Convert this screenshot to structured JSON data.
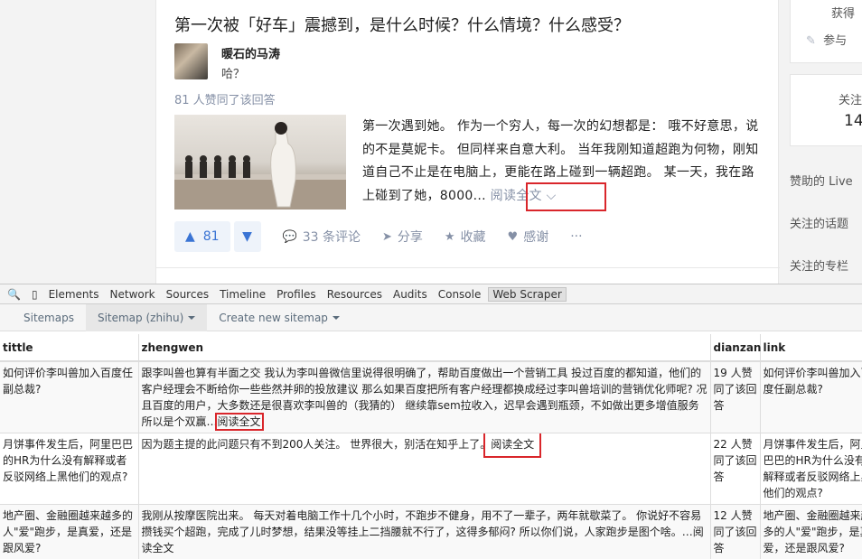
{
  "question": {
    "title": "第一次被「好车」震撼到，是什么时候？什么情境？什么感受？",
    "author": "暖石的马涛",
    "bio": "哈？",
    "likes": "81 人赞同了该回答",
    "answer_text": "第一次遇到她。 作为一个穷人，每一次的幻想都是： 哦不好意思，说的不是莫妮卡。 但同样来自意大利。 当年我刚知道超跑为何物，刚知道自己不止是在电脑上，更能在路上碰到一辆超跑。 某一天，我在路上碰到了她，8000...",
    "read_full": "阅读全文",
    "vote_count": "81",
    "actions": {
      "comments": "33 条评论",
      "share": "分享",
      "collect": "收藏",
      "thanks": "感谢",
      "more": "···"
    }
  },
  "right_sidebar": {
    "item1": "获得",
    "item2": "参与",
    "follow_label": "关注",
    "follow_count": "14",
    "live": "赞助的 Live",
    "topics": "关注的话题",
    "columns": "关注的专栏"
  },
  "devtools": {
    "tabs": [
      "Elements",
      "Network",
      "Sources",
      "Timeline",
      "Profiles",
      "Resources",
      "Audits",
      "Console",
      "Web Scraper"
    ],
    "active_tab": "Web Scraper"
  },
  "scraper": {
    "nav": [
      "Sitemaps",
      "Sitemap (zhihu)",
      "Create new sitemap"
    ],
    "columns": [
      "tittle",
      "zhengwen",
      "dianzan",
      "link"
    ],
    "rows": [
      {
        "tittle": "如何评价李叫兽加入百度任副总裁?",
        "zhengwen": "跟李叫兽也算有半面之交 我认为李叫兽微信里说得很明确了，帮助百度做出一个营销工具 投过百度的都知道，他们的客户经理会不断给你一些些然并卵的投放建议 那么如果百度把所有客户经理都换成经过李叫兽培训的营销优化师呢? 况且百度的用户，大多数还是很喜欢李叫兽的（我猜的） 继续靠sem拉收入，迟早会遇到瓶颈，不如做出更多增值服务 所以是个双赢…",
        "zhengwen_link": "阅读全文",
        "dianzan": "19 人赞同了该回答",
        "link": "如何评价李叫兽加入百度任副总裁?"
      },
      {
        "tittle": "月饼事件发生后，阿里巴巴的HR为什么没有解释或者反驳网络上黑他们的观点?",
        "zhengwen": "因为题主提的此问题只有不到200人关注。 世界很大，别活在知乎上了。",
        "zhengwen_link": "阅读全文",
        "dianzan": "22 人赞同了该回答",
        "link": "月饼事件发生后，阿里巴巴的HR为什么没有解释或者反驳网络上黑他们的观点?"
      },
      {
        "tittle": "地产圈、金融圈越来越多的人\"爱\"跑步，是真爱，还是跟风爱?",
        "zhengwen": "我刚从按摩医院出来。 每天对着电脑工作十几个小时，不跑步不健身，用不了一辈子，两年就歇菜了。 你说好不容易攒钱买个超跑，完成了儿时梦想，结果没等挂上二挡腰就不行了，这得多郁闷? 所以你们说，人家跑步是图个啥。…",
        "zhengwen_link": "阅读全文",
        "dianzan": "12 人赞同了该回答",
        "link": "地产圈、金融圈越来越多的人\"爱\"跑步，是真爱，还是跟风爱?"
      }
    ]
  },
  "colors": {
    "accent_blue": "#3a74d4",
    "muted": "#8590a6",
    "highlight_red": "#d9262b"
  }
}
